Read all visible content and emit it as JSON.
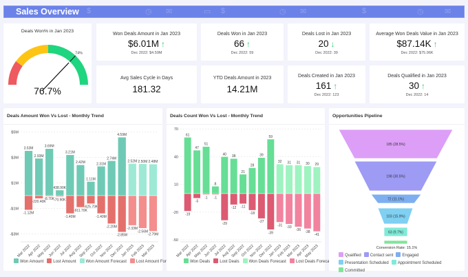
{
  "header": {
    "title": "Sales Overview",
    "decor_icons": [
      "dollar-icon",
      "chart-icon",
      "contact-icon",
      "clock-icon",
      "mail-icon",
      "handshake-icon",
      "chat-icon"
    ]
  },
  "gauge": {
    "label": "Deals Won% in Jan 2023",
    "value": "76.7%",
    "value_pct": 76.7,
    "target_label": "74%",
    "target_pct": 74,
    "colors": {
      "red": "#ee5a5f",
      "yellow": "#fdc414",
      "green": "#1fd57f"
    }
  },
  "kpis": [
    {
      "label": "Won Deals Amount in Jan 2023",
      "value": "$6.01M",
      "trend": "↑",
      "compare": "Dec 2022: $4.59M"
    },
    {
      "label": "Deals Won in Jan 2023",
      "value": "66",
      "trend": "↑",
      "compare": "Dec 2022: 59"
    },
    {
      "label": "Deals Lost in Jan 2023",
      "value": "20",
      "trend": "↓",
      "compare": "Dec 2022: 39"
    },
    {
      "label": "Average Won Deals Value in Jan 2023",
      "value": "$87.14K",
      "trend": "↑",
      "compare": "Dec 2022: $75.96K"
    },
    {
      "label": "Avg Sales Cycle in Days",
      "value": "181.32"
    },
    {
      "label": "YTD Deals Amount in 2023",
      "value": "14.21M"
    },
    {
      "label": "Deals Created in Jan 2023",
      "value": "161",
      "trend": "↑",
      "compare": "Dec 2022: 123"
    },
    {
      "label": "Deals Qualified in Jan 2023",
      "value": "30",
      "trend": "↑",
      "compare": "Dec 2022: 14"
    }
  ],
  "chart_data": [
    {
      "type": "bar",
      "title": "Deals Amount Won Vs Lost - Monthly Trend",
      "categories": [
        "Mar 2022",
        "Apr 2022",
        "May 2022",
        "Jun 2022",
        "Jul 2022",
        "Aug 2022",
        "Sep 2022",
        "Oct 2022",
        "Nov 2022",
        "Dec 2022",
        "Jan 2023",
        "Feb 2023",
        "Mar 2023"
      ],
      "yticks": [
        "$5M",
        "$3M",
        "$1M",
        "-$1M",
        "-$3M"
      ],
      "ytick_values": [
        5,
        3,
        1,
        -1,
        -3
      ],
      "forecast_from_index": 10,
      "series": [
        {
          "name": "Won Amount",
          "color": "#6fcab5",
          "values": [
            3.53,
            2.93,
            3.69,
            0.4389,
            3.21,
            2.42,
            1.11,
            2.31,
            2.74,
            4.59,
            null,
            null,
            null
          ],
          "labels": [
            "3.53M",
            "2.93M",
            "3.69M",
            "438.90K",
            "3.21M",
            "2.42M",
            "1.11M",
            "2.31M",
            "2.74M",
            "4.59M",
            "",
            "",
            ""
          ]
        },
        {
          "name": "Lost Amount",
          "color": "#e4706c",
          "values": [
            -1.12,
            -0.2204,
            -0.0087,
            -0.0709,
            -1.4,
            -0.9117,
            -0.6257,
            -1.4,
            -2.2,
            -2.85,
            null,
            null,
            null
          ],
          "labels": [
            "-1.12M",
            "-220.40K",
            "-8.70K",
            "-70.90K",
            "-1.40M",
            "-911.70K",
            "-625.70K",
            "-1.40M",
            "-2.20M",
            "-2.85M",
            "",
            "",
            ""
          ]
        },
        {
          "name": "Won Amount Forecast",
          "color": "#9ee9d6",
          "values": [
            null,
            null,
            null,
            null,
            null,
            null,
            null,
            null,
            null,
            null,
            2.52,
            2.5,
            2.48
          ],
          "labels": [
            "",
            "",
            "",
            "",
            "",
            "",
            "",
            "",
            "",
            "",
            "2.52M",
            "2.50M",
            "2.48M"
          ]
        },
        {
          "name": "Lost Amount Forecast",
          "color": "#f38e8d",
          "values": [
            null,
            null,
            null,
            null,
            null,
            null,
            null,
            null,
            null,
            null,
            -2.33,
            -2.56,
            -2.79
          ],
          "labels": [
            "",
            "",
            "",
            "",
            "",
            "",
            "",
            "",
            "",
            "",
            "-2.33M",
            "-2.56M",
            "-2.79M"
          ]
        }
      ]
    },
    {
      "type": "bar",
      "title": "Deals Count Won Vs Lost - Monthly Trend",
      "categories": [
        "Mar 2022",
        "Apr 2022",
        "May 2022",
        "Jun 2022",
        "Jul 2022",
        "Aug 2022",
        "Sep 2022",
        "Oct 2022",
        "Nov 2022",
        "Dec 2022",
        "Jan 2023",
        "Feb 2023",
        "Mar 2023",
        "Apr 2023",
        "May 2023"
      ],
      "yticks": [
        "70",
        "40",
        "10",
        "-20",
        "-50"
      ],
      "ytick_values": [
        70,
        40,
        10,
        -20,
        -50
      ],
      "series": [
        {
          "name": "Won Deals",
          "color": "#66de95",
          "values": [
            61,
            47,
            51,
            8,
            40,
            38,
            21,
            28,
            39,
            59,
            null,
            null,
            null,
            null,
            null
          ]
        },
        {
          "name": "Lost Deals",
          "color": "#dc5a72",
          "values": [
            -19,
            -5,
            -1,
            -1,
            -29,
            -12,
            -11,
            -18,
            -27,
            -39,
            null,
            null,
            null,
            null,
            null
          ]
        },
        {
          "name": "Won Deals Forecast",
          "color": "#9ef3c0",
          "values": [
            null,
            null,
            null,
            null,
            null,
            null,
            null,
            null,
            null,
            null,
            32,
            31,
            31,
            30,
            29
          ]
        },
        {
          "name": "Lost Deals Forecast",
          "color": "#f2839f",
          "values": [
            null,
            null,
            null,
            null,
            null,
            null,
            null,
            null,
            null,
            null,
            -31,
            -33,
            -36,
            -38,
            -41
          ]
        }
      ]
    },
    {
      "type": "funnel",
      "title": "Opportunities Pipeline",
      "stages": [
        {
          "name": "Qualified",
          "label": "185 (28.5%)",
          "value": 185,
          "color": "#dc9ef6"
        },
        {
          "name": "Contact sent",
          "label": "198 (30.5%)",
          "value": 198,
          "color": "#9d9bf4"
        },
        {
          "name": "Engaged",
          "label": "72 (11.1%)",
          "value": 72,
          "color": "#7daef0"
        },
        {
          "name": "Presentation Scheduled",
          "label": "103 (15.9%)",
          "value": 103,
          "color": "#7fd0f2"
        },
        {
          "name": "Appointment Scheduled",
          "label": "63 (9.7%)",
          "value": 63,
          "color": "#80ead8"
        },
        {
          "name": "Committed",
          "label": "",
          "value": null,
          "color": "#7fe59a"
        }
      ],
      "conversion_rate": "Conversion Rate: 15.1%"
    }
  ]
}
